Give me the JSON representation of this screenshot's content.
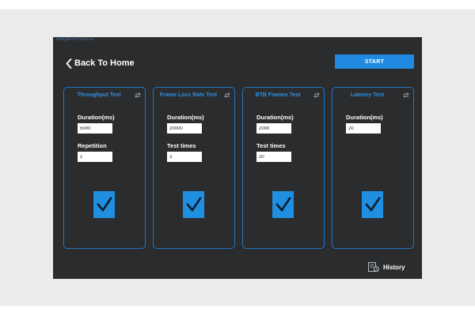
{
  "app": {
    "label": "Netperformance"
  },
  "header": {
    "back_label": "Back To Home",
    "start_label": "START"
  },
  "cards": [
    {
      "title": "Throughput Test",
      "fields": [
        {
          "label": "Duration(ms)",
          "value": "5000"
        },
        {
          "label": "Repetition",
          "value": "1"
        }
      ],
      "checked": true
    },
    {
      "title": "Frame Loss Rate Test",
      "fields": [
        {
          "label": "Duration(ms)",
          "value": "20000"
        },
        {
          "label": "Test times",
          "value": "2"
        }
      ],
      "checked": true
    },
    {
      "title": "BTB Frames Test",
      "fields": [
        {
          "label": "Duration(ms)",
          "value": "2000"
        },
        {
          "label": "Test times",
          "value": "20"
        }
      ],
      "checked": true
    },
    {
      "title": "Latency Test",
      "fields": [
        {
          "label": "Duration(ms)",
          "value": "20"
        }
      ],
      "checked": true
    }
  ],
  "footer": {
    "history_label": "History"
  },
  "colors": {
    "accent": "#1f8ae0",
    "background": "#2b2c2e",
    "card_border": "#1f75c2"
  }
}
